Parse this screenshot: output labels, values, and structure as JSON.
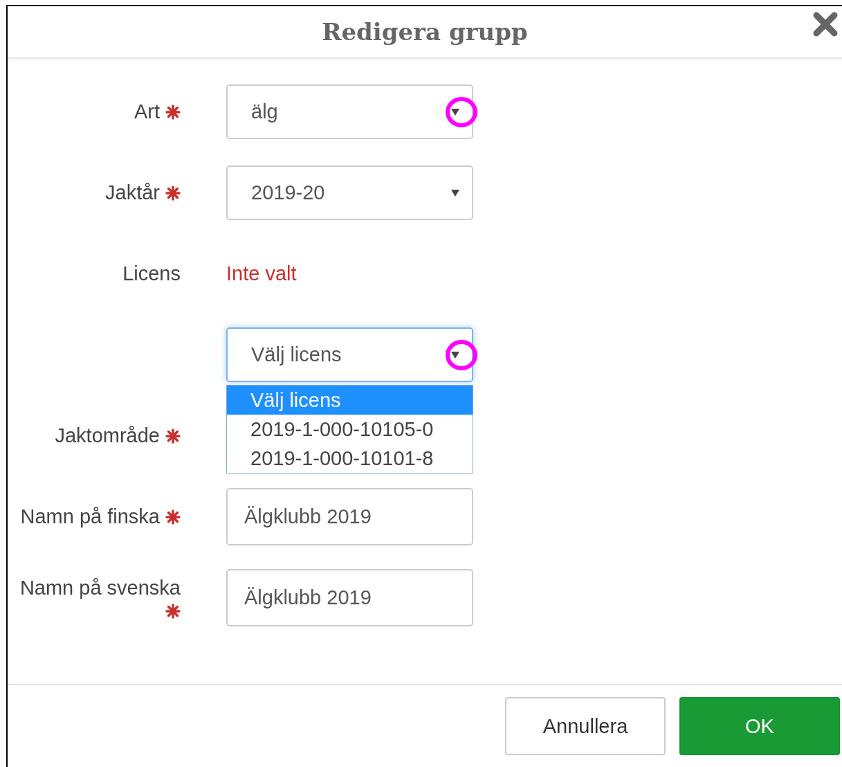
{
  "dialog": {
    "title": "Redigera grupp"
  },
  "fields": [
    {
      "kind": "select",
      "label": "Art",
      "required": true,
      "value": "älg",
      "focused": false,
      "circled": true
    },
    {
      "kind": "select",
      "label": "Jaktår",
      "required": true,
      "value": "2019-20",
      "focused": false,
      "circled": false
    },
    {
      "kind": "status",
      "label": "Licens",
      "required": false,
      "value": "Inte valt"
    },
    {
      "kind": "select",
      "value": "Välj licens",
      "focused": true,
      "circled": true,
      "options": [
        {
          "label": "Välj licens",
          "selected": true
        },
        {
          "label": "2019-1-000-10105-0",
          "selected": false
        },
        {
          "label": "2019-1-000-10101-8",
          "selected": false
        }
      ]
    },
    {
      "kind": "covered",
      "label": "Jaktområde",
      "required": true
    },
    {
      "kind": "input",
      "label": "Namn på finska",
      "required": true,
      "value": "Älgklubb 2019"
    },
    {
      "kind": "input",
      "label": "Namn på svenska",
      "required": true,
      "value": "Älgklubb 2019"
    }
  ],
  "buttons": [
    {
      "kind": "secondary",
      "label": "Annullera"
    },
    {
      "kind": "primary",
      "label": "OK"
    }
  ]
}
